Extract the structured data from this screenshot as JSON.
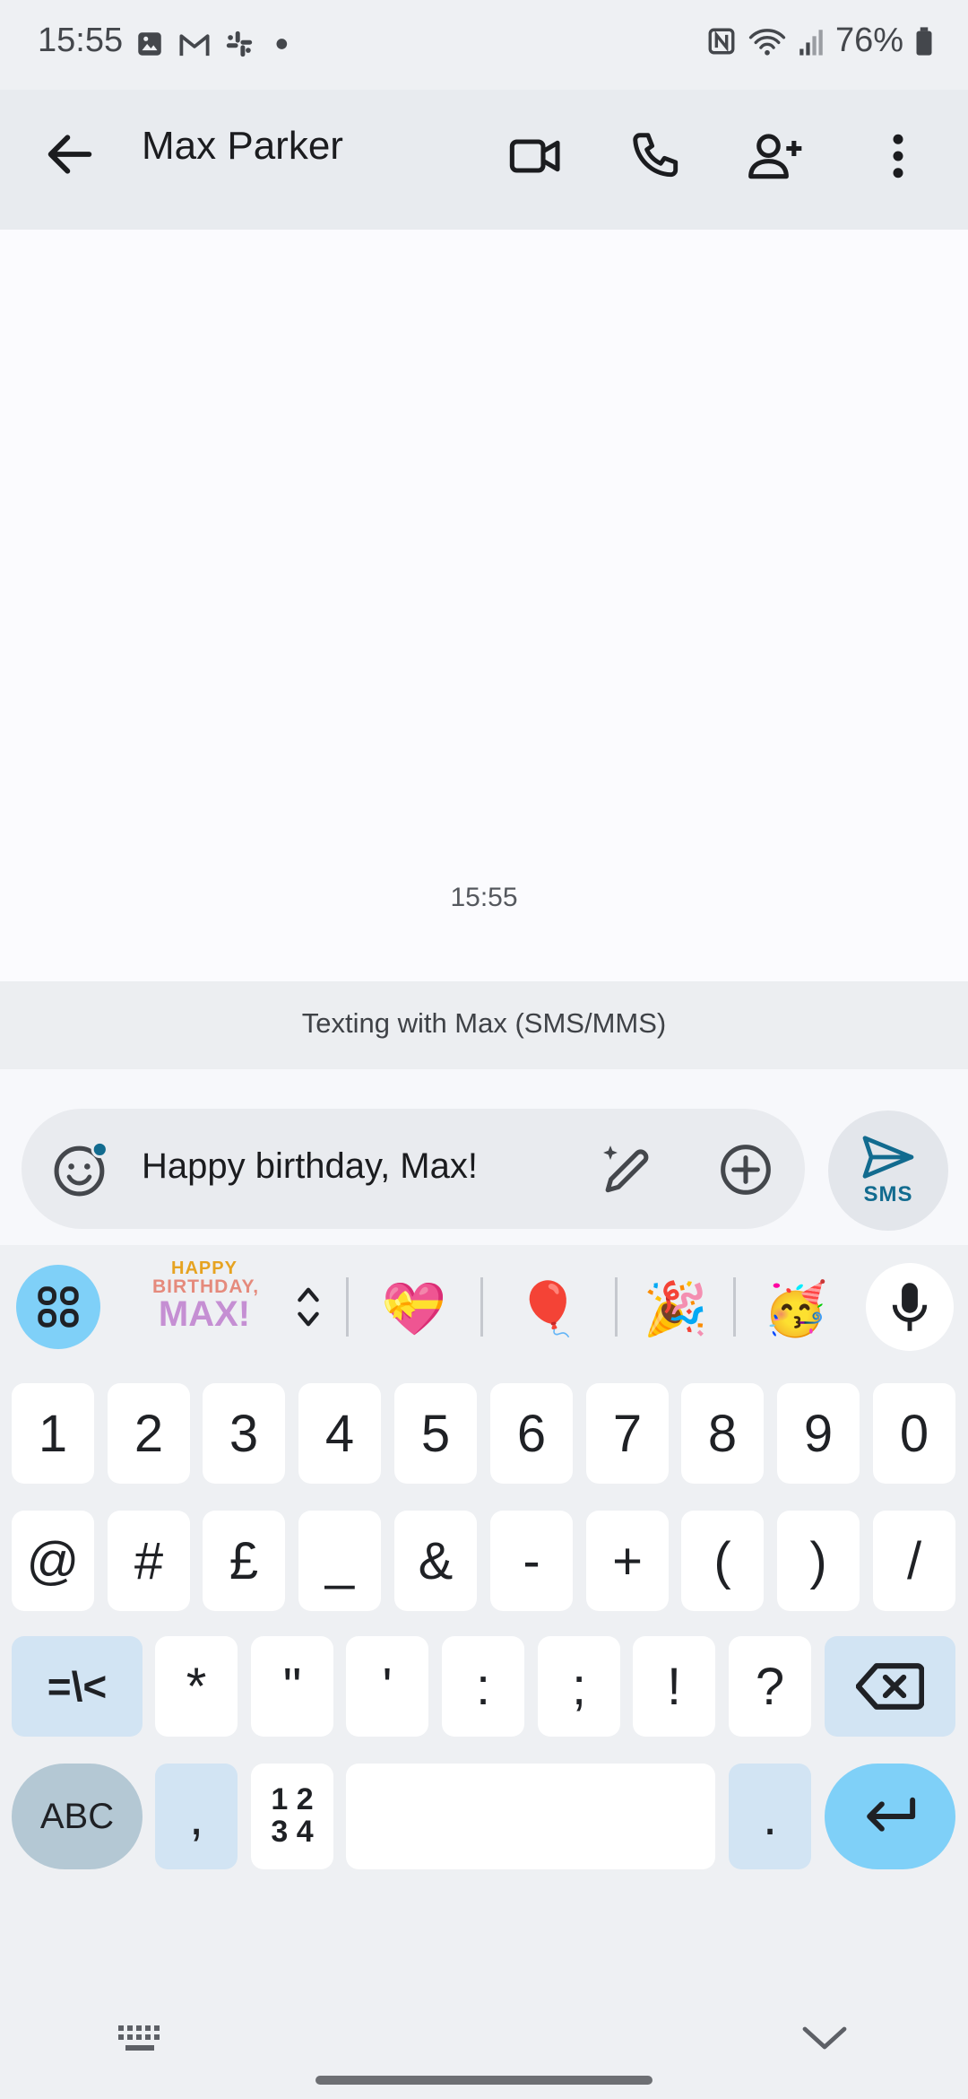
{
  "status_bar": {
    "time": "15:55",
    "left_icons": [
      "image-icon",
      "gmail-icon",
      "slack-icon",
      "dot-icon"
    ],
    "right_icons": [
      "nfc-icon",
      "wifi-icon",
      "signal-icon",
      "battery-icon"
    ],
    "battery": "76%"
  },
  "app_bar": {
    "title": "Max Parker",
    "actions": [
      "video-call-icon",
      "phone-icon",
      "add-person-icon",
      "more-vert-icon"
    ]
  },
  "conversation": {
    "timestamp": "15:55",
    "info": "Texting with Max (SMS/MMS)"
  },
  "compose": {
    "text": "Happy birthday, Max!",
    "send_label": "SMS"
  },
  "keyboard": {
    "sticker": {
      "line1": "HAPPY",
      "line2": "BIRTHDAY,",
      "line3": "MAX!"
    },
    "emoji_suggestions": [
      "💝",
      "🎈",
      "🎉",
      "🥳"
    ],
    "row1": [
      "1",
      "2",
      "3",
      "4",
      "5",
      "6",
      "7",
      "8",
      "9",
      "0"
    ],
    "row2": [
      "@",
      "#",
      "£",
      "_",
      "&",
      "-",
      "+",
      "(",
      ")",
      "/"
    ],
    "row3": [
      "*",
      "\"",
      "'",
      ":",
      ";",
      "!",
      "?"
    ],
    "sym_toggle": "=\\<",
    "abc": "ABC",
    "comma": ",",
    "num_toggle_top": "1 2",
    "num_toggle_bottom": "3 4",
    "period": "."
  }
}
